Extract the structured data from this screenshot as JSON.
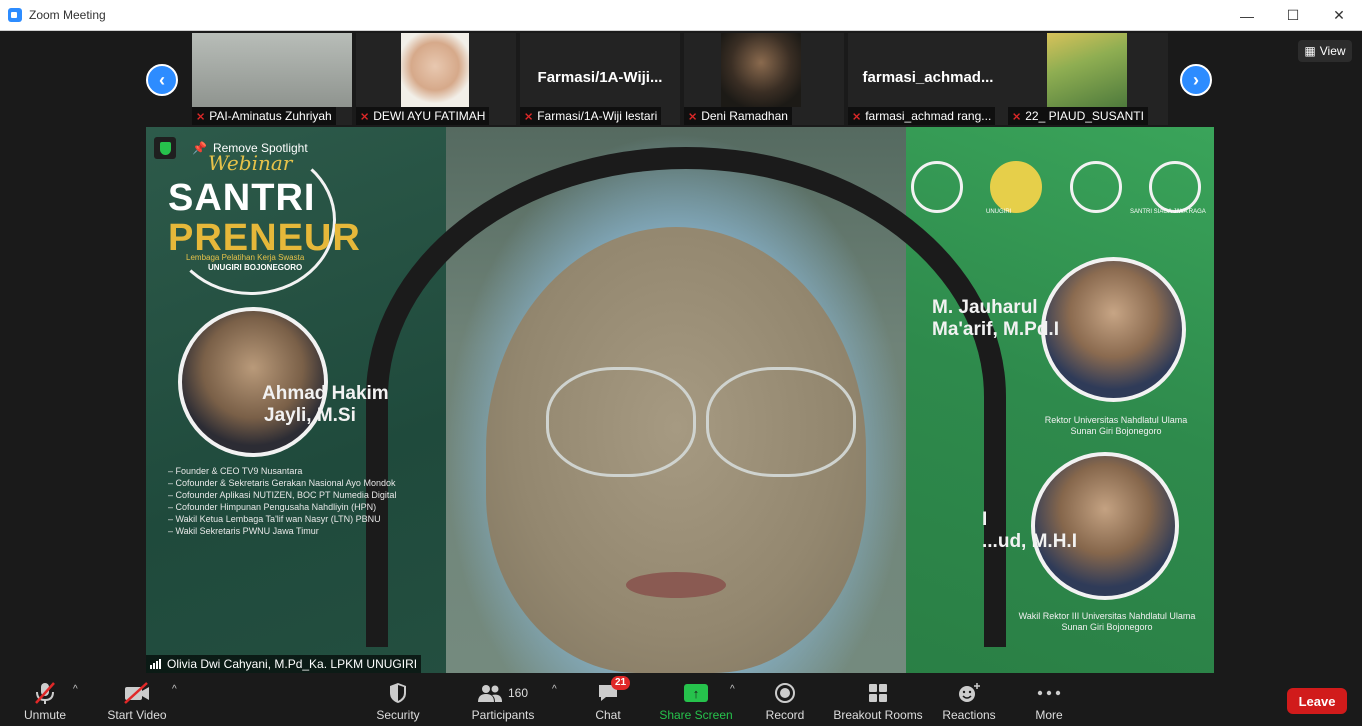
{
  "window": {
    "title": "Zoom Meeting",
    "controls": {
      "minimize": "—",
      "maximize": "☐",
      "close": "✕"
    }
  },
  "strip": {
    "view_label": "View",
    "prev_icon": "chevron-left-icon",
    "next_icon": "chevron-right-icon",
    "participants": [
      {
        "name": "PAI-Aminatus Zuhriyah",
        "muted": true,
        "video": true
      },
      {
        "name": "DEWI AYU FATIMAH",
        "muted": true,
        "video": true
      },
      {
        "name": "Farmasi/1A-Wiji lestari",
        "display": "Farmasi/1A-Wiji...",
        "muted": true,
        "video": false
      },
      {
        "name": "Deni Ramadhan",
        "muted": true,
        "video": true
      },
      {
        "name": "farmasi_achmad rang...",
        "display": "farmasi_achmad...",
        "muted": true,
        "video": false
      },
      {
        "name": "22_ PIAUD_SUSANTI",
        "muted": true,
        "video": true
      }
    ]
  },
  "main_video": {
    "spotlight_label": "Remove Spotlight",
    "speaker_name": "Olivia Dwi Cahyani, M.Pd_Ka. LPKM UNUGIRI",
    "banner": {
      "script_title": "Webinar",
      "title_line1": "SANTRI",
      "title_line2": "PRENEUR",
      "sub1": "Lembaga Pelatihan Kerja Swasta",
      "sub2": "UNUGIRI BOJONEGORO",
      "speaker_left_name": [
        "Ahmad Hakim",
        "Jayli, M.Si"
      ],
      "speaker_left_roles": [
        "– Founder & CEO TV9 Nusantara",
        "– Cofounder & Sekretaris Gerakan Nasional Ayo Mondok",
        "– Cofounder Aplikasi NUTIZEN, BOC PT Numedia Digital",
        "– Cofounder Himpunan Pengusaha Nahdliyin (HPN)",
        "– Wakil Ketua Lembaga Ta'lif wan Nasyr (LTN) PBNU",
        "– Wakil Sekretaris PWNU Jawa Timur"
      ],
      "speaker_right1_name": [
        "M. Jauharul",
        "Ma'arif, M.Pd.I"
      ],
      "speaker_right1_desc": [
        "Rektor Universitas Nahdlatul Ulama",
        "Sunan Giri Bojonegoro"
      ],
      "speaker_right2_name": [
        "I",
        "...ud, M.H.I"
      ],
      "speaker_right2_desc": [
        "Wakil Rektor III Universitas Nahdlatul Ulama",
        "Sunan Giri Bojonegoro"
      ],
      "logo_caption1": "UNUGIRI",
      "logo_caption2": "SANTRI SIAGA JIWA RAGA"
    }
  },
  "toolbar": {
    "unmute": "Unmute",
    "start_video": "Start Video",
    "security": "Security",
    "participants": "Participants",
    "participants_count": "160",
    "chat": "Chat",
    "chat_badge": "21",
    "share_screen": "Share Screen",
    "record": "Record",
    "breakout_rooms": "Breakout Rooms",
    "reactions": "Reactions",
    "more": "More",
    "leave": "Leave"
  },
  "colors": {
    "accent": "#2d8cff",
    "share_green": "#26c24c",
    "leave_red": "#d11b1b",
    "muted_red": "#e02828"
  }
}
